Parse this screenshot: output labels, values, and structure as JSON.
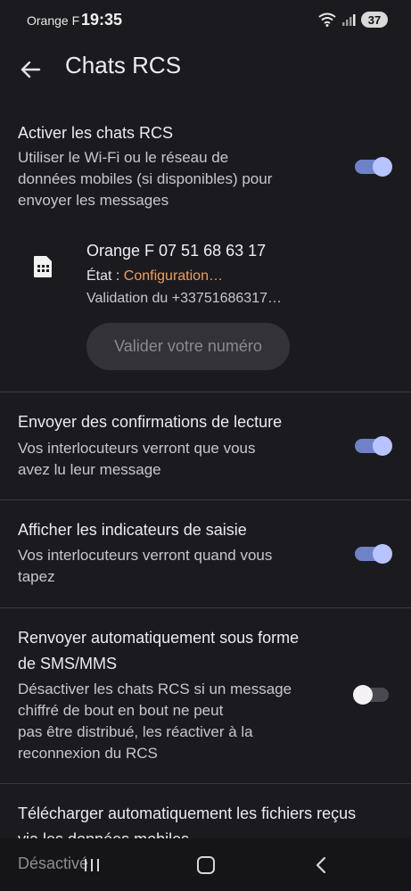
{
  "status_bar": {
    "carrier": "Orange F",
    "time": "19:35",
    "battery": "37"
  },
  "app_bar": {
    "title": "Chats RCS"
  },
  "settings": [
    {
      "title": "Activer les chats RCS",
      "subtitle": [
        "Utiliser le Wi-Fi ou le réseau de",
        "données mobiles (si disponibles) pour",
        "envoyer les messages"
      ],
      "enabled": true
    },
    {
      "title": "Envoyer des confirmations de lecture",
      "subtitle": [
        "Vos interlocuteurs verront que vous",
        "avez lu leur message"
      ],
      "enabled": true
    },
    {
      "title": "Afficher les indicateurs de saisie",
      "subtitle": [
        "Vos interlocuteurs verront quand vous",
        "tapez"
      ],
      "enabled": true
    },
    {
      "title": [
        "Renvoyer automatiquement sous forme",
        "de SMS/MMS"
      ],
      "subtitle": [
        "Désactiver les chats RCS si un message",
        "chiffré de bout en bout ne peut",
        "pas être distribué, les réactiver à la",
        "reconnexion du RCS"
      ],
      "enabled": false
    },
    {
      "title": [
        "Télécharger automatiquement les fichiers reçus",
        "via les données mobiles"
      ]
    }
  ],
  "sim": {
    "number": "Orange F 07 51 68 63 17",
    "state_label": "État : ",
    "state_value": "Configuration…",
    "validation": "Validation du +33751686317…",
    "validate_button": "Valider votre numéro"
  },
  "nav_bar": {
    "overlap_text": "Désactivé"
  },
  "colors": {
    "background": "#1b1b1f",
    "toggle_on": "#b7c4ff",
    "state_accent": "#f19d5c"
  }
}
